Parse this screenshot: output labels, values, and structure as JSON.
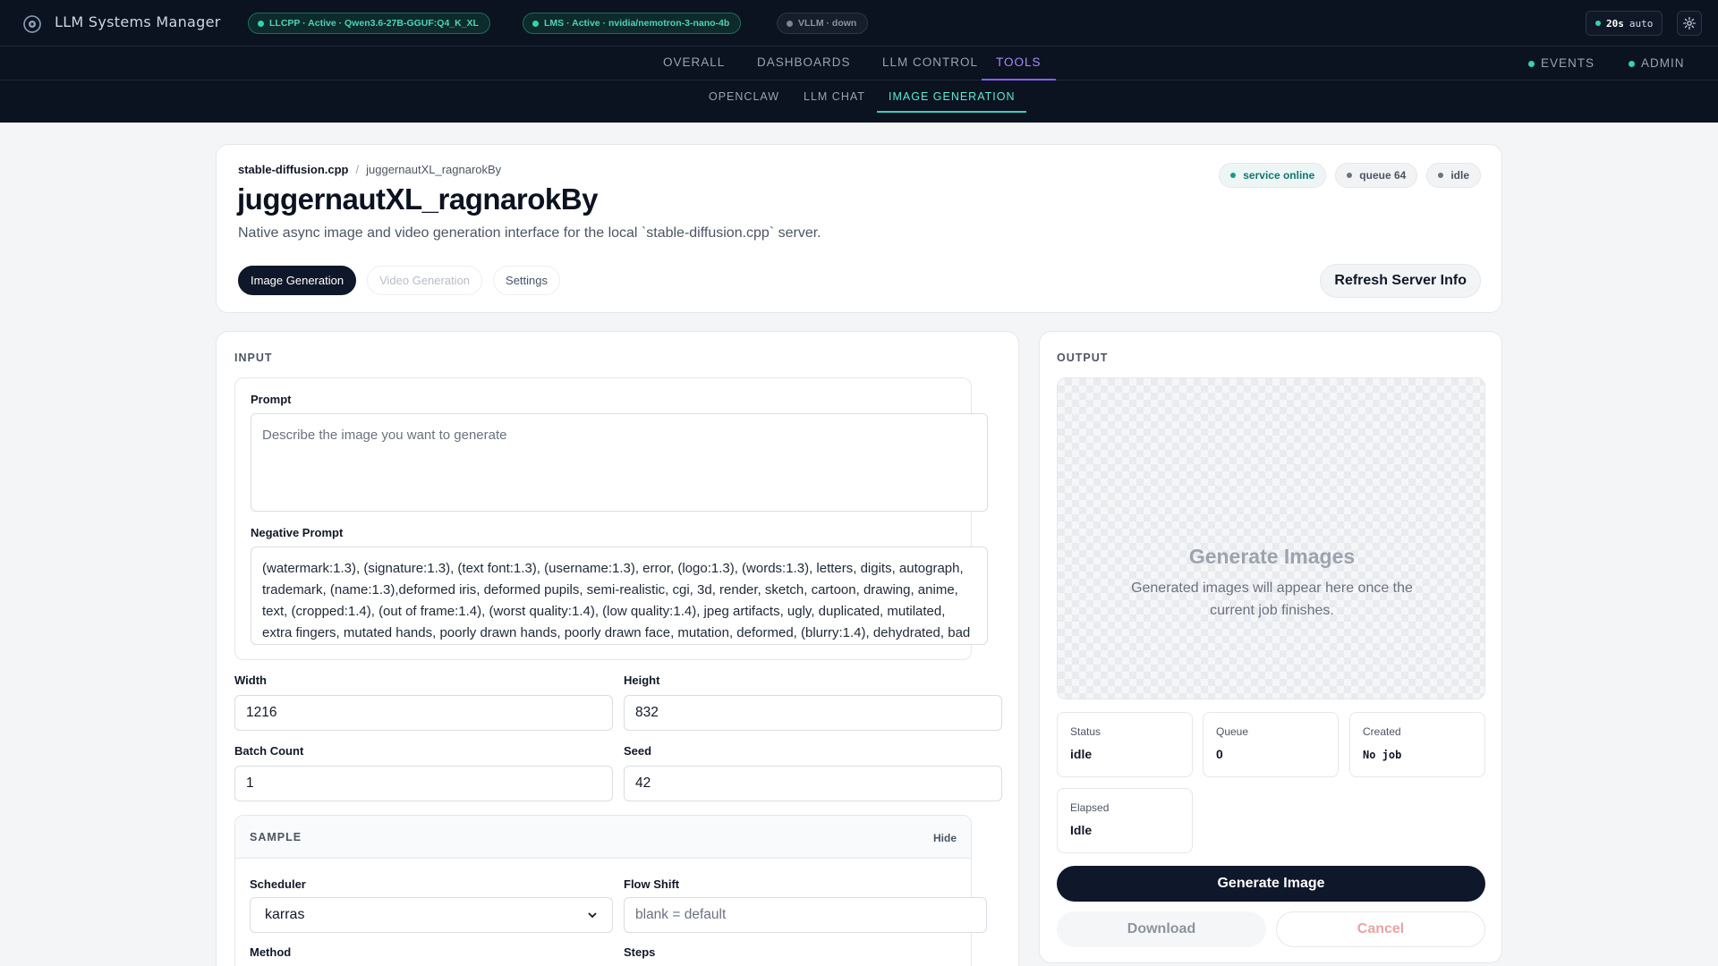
{
  "app": {
    "title": "LLM Systems Manager",
    "logo_icon": "orbit-logo-icon"
  },
  "services": [
    {
      "label": "LLCPP · Active · Qwen3.6-27B-GGUF:Q4_K_XL",
      "state": "active"
    },
    {
      "label": "LMS · Active · nvidia/nemotron-3-nano-4b",
      "state": "active"
    },
    {
      "label": "VLLM · down",
      "state": "down"
    }
  ],
  "refresh": {
    "interval": "20s",
    "mode": "auto"
  },
  "settings_icon": "gear-icon",
  "main_nav": {
    "items": [
      "OVERALL",
      "DASHBOARDS",
      "LLM CONTROL",
      "TOOLS"
    ],
    "active": "TOOLS",
    "right": [
      "EVENTS",
      "ADMIN"
    ]
  },
  "sub_nav": {
    "items": [
      "OPENCLAW",
      "LLM CHAT",
      "IMAGE GENERATION"
    ],
    "active": "IMAGE GENERATION"
  },
  "header": {
    "breadcrumb_root": "stable-diffusion.cpp",
    "breadcrumb_sep": "/",
    "breadcrumb_leaf": "juggernautXL_ragnarokBy",
    "title": "juggernautXL_ragnarokBy",
    "subtitle": "Native async image and video generation interface for the local `stable-diffusion.cpp` server.",
    "status": {
      "service": "service online",
      "queue": "queue 64",
      "state": "idle"
    },
    "tabs": [
      "Image Generation",
      "Video Generation",
      "Settings"
    ],
    "refresh_button": "Refresh Server Info"
  },
  "input": {
    "section": "INPUT",
    "prompt_label": "Prompt",
    "prompt_placeholder": "Describe the image you want to generate",
    "prompt_value": "",
    "negative_label": "Negative Prompt",
    "negative_value": "(watermark:1.3), (signature:1.3), (text font:1.3), (username:1.3), error, (logo:1.3), (words:1.3), letters, digits, autograph, trademark, (name:1.3),deformed iris, deformed pupils, semi-realistic, cgi, 3d, render, sketch, cartoon, drawing, anime, text, (cropped:1.4), (out of frame:1.4), (worst quality:1.4), (low quality:1.4), jpeg artifacts, ugly, duplicated, mutilated, extra fingers, mutated hands, poorly drawn hands, poorly drawn face, mutation, deformed, (blurry:1.4), dehydrated, bad",
    "width_label": "Width",
    "width_value": "1216",
    "height_label": "Height",
    "height_value": "832",
    "batch_label": "Batch Count",
    "batch_value": "1",
    "seed_label": "Seed",
    "seed_value": "42",
    "sample": {
      "section": "SAMPLE",
      "hide": "Hide",
      "scheduler_label": "Scheduler",
      "scheduler_value": "karras",
      "flow_shift_label": "Flow Shift",
      "flow_shift_placeholder": "blank = default",
      "method_label": "Method",
      "steps_label": "Steps"
    }
  },
  "output": {
    "section": "OUTPUT",
    "empty_title": "Generate Images",
    "empty_message": "Generated images will appear here once the current job finishes.",
    "stats": {
      "status_label": "Status",
      "status_value": "idle",
      "queue_label": "Queue",
      "queue_value": "0",
      "created_label": "Created",
      "created_value": "No job",
      "elapsed_label": "Elapsed",
      "elapsed_value": "Idle"
    },
    "generate_button": "Generate Image",
    "download_button": "Download",
    "cancel_button": "Cancel"
  },
  "colors": {
    "topbar_bg": "#0b1220",
    "active_teal": "#34d3b0",
    "tools_purple": "#8b5cf6",
    "primary_button": "#0f172a"
  }
}
